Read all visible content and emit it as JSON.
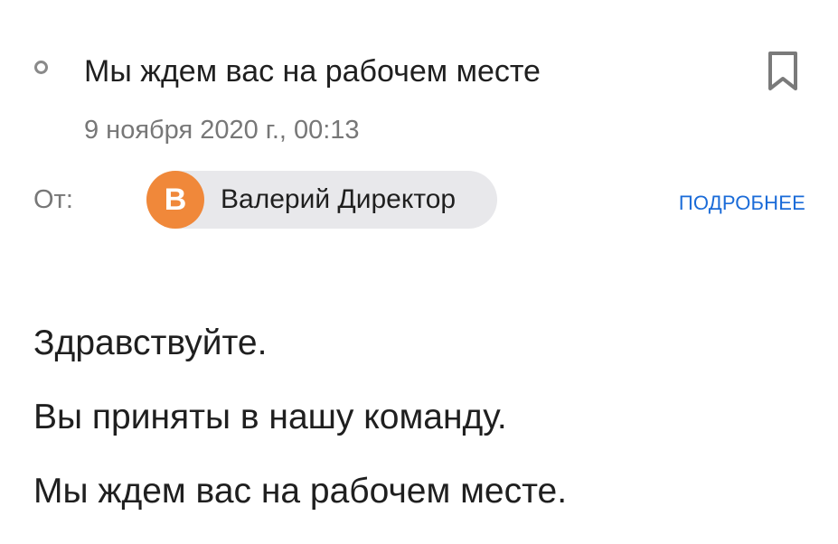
{
  "email": {
    "subject": "Мы ждем вас на рабочем месте",
    "date": "9 ноября 2020 г., 00:13",
    "from_label": "От:",
    "sender": {
      "initial": "В",
      "name": "Валерий Директор",
      "avatar_color": "#f0883a"
    },
    "details_link": "ПОДРОБНЕЕ",
    "icons": {
      "unread": "unread-circle-icon",
      "bookmark": "bookmark-icon"
    },
    "body_lines": [
      "Здравствуйте.",
      "Вы приняты в нашу команду.",
      "Мы ждем вас на рабочем месте."
    ]
  },
  "colors": {
    "accent": "#1a6bd8",
    "secondary_text": "#777777",
    "chip_background": "#e8e8eb"
  }
}
